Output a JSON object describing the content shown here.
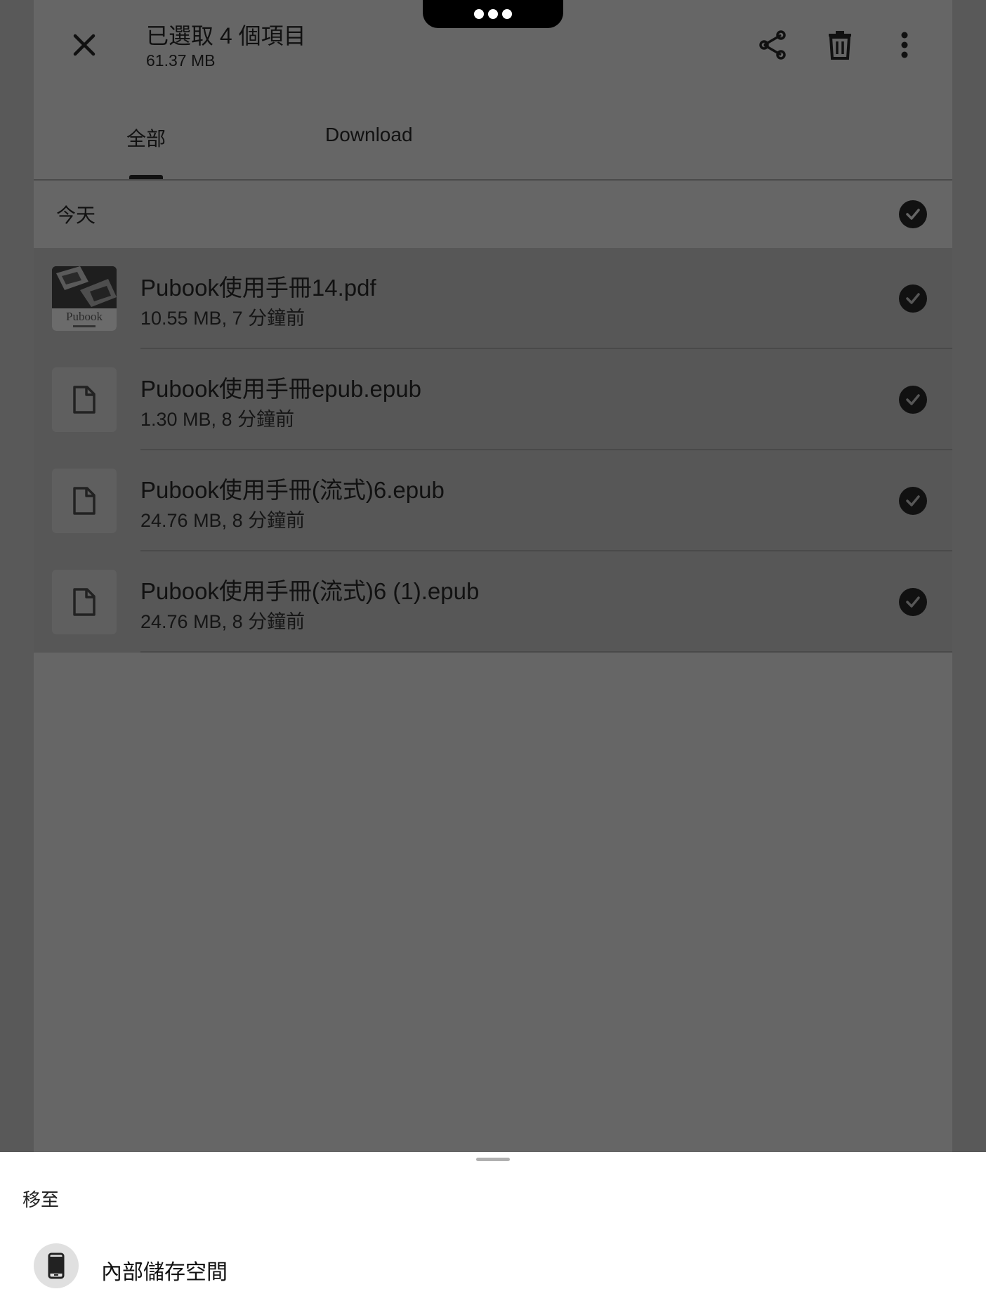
{
  "notch": {
    "icon": "more-dots-icon"
  },
  "appbar": {
    "title": "已選取 4 個項目",
    "size": "61.37 MB",
    "close_icon": "close-icon",
    "share_icon": "share-icon",
    "delete_icon": "trash-icon",
    "more_icon": "more-vert-icon"
  },
  "tabs": [
    {
      "label": "全部",
      "selected": true
    },
    {
      "label": "Download",
      "selected": false
    }
  ],
  "section": {
    "label": "今天",
    "checked": true
  },
  "files": [
    {
      "name": "Pubook使用手冊14.pdf",
      "meta": "10.55 MB, 7 分鐘前",
      "thumb": "pdf-thumbnail",
      "thumb_text": "Pubook",
      "checked": true
    },
    {
      "name": "Pubook使用手冊epub.epub",
      "meta": "1.30 MB, 8 分鐘前",
      "thumb": "file-icon",
      "checked": true
    },
    {
      "name": "Pubook使用手冊(流式)6.epub",
      "meta": "24.76 MB, 8 分鐘前",
      "thumb": "file-icon",
      "checked": true
    },
    {
      "name": "Pubook使用手冊(流式)6 (1).epub",
      "meta": "24.76 MB, 8 分鐘前",
      "thumb": "file-icon",
      "checked": true
    }
  ],
  "sheet": {
    "title": "移至",
    "destination": {
      "label": "內部儲存空間",
      "icon": "phone-icon"
    }
  },
  "colors": {
    "scrim": "#595959",
    "card": "#666666",
    "selected_row": "#575757",
    "sheet": "#ffffff",
    "check": "#111111"
  }
}
